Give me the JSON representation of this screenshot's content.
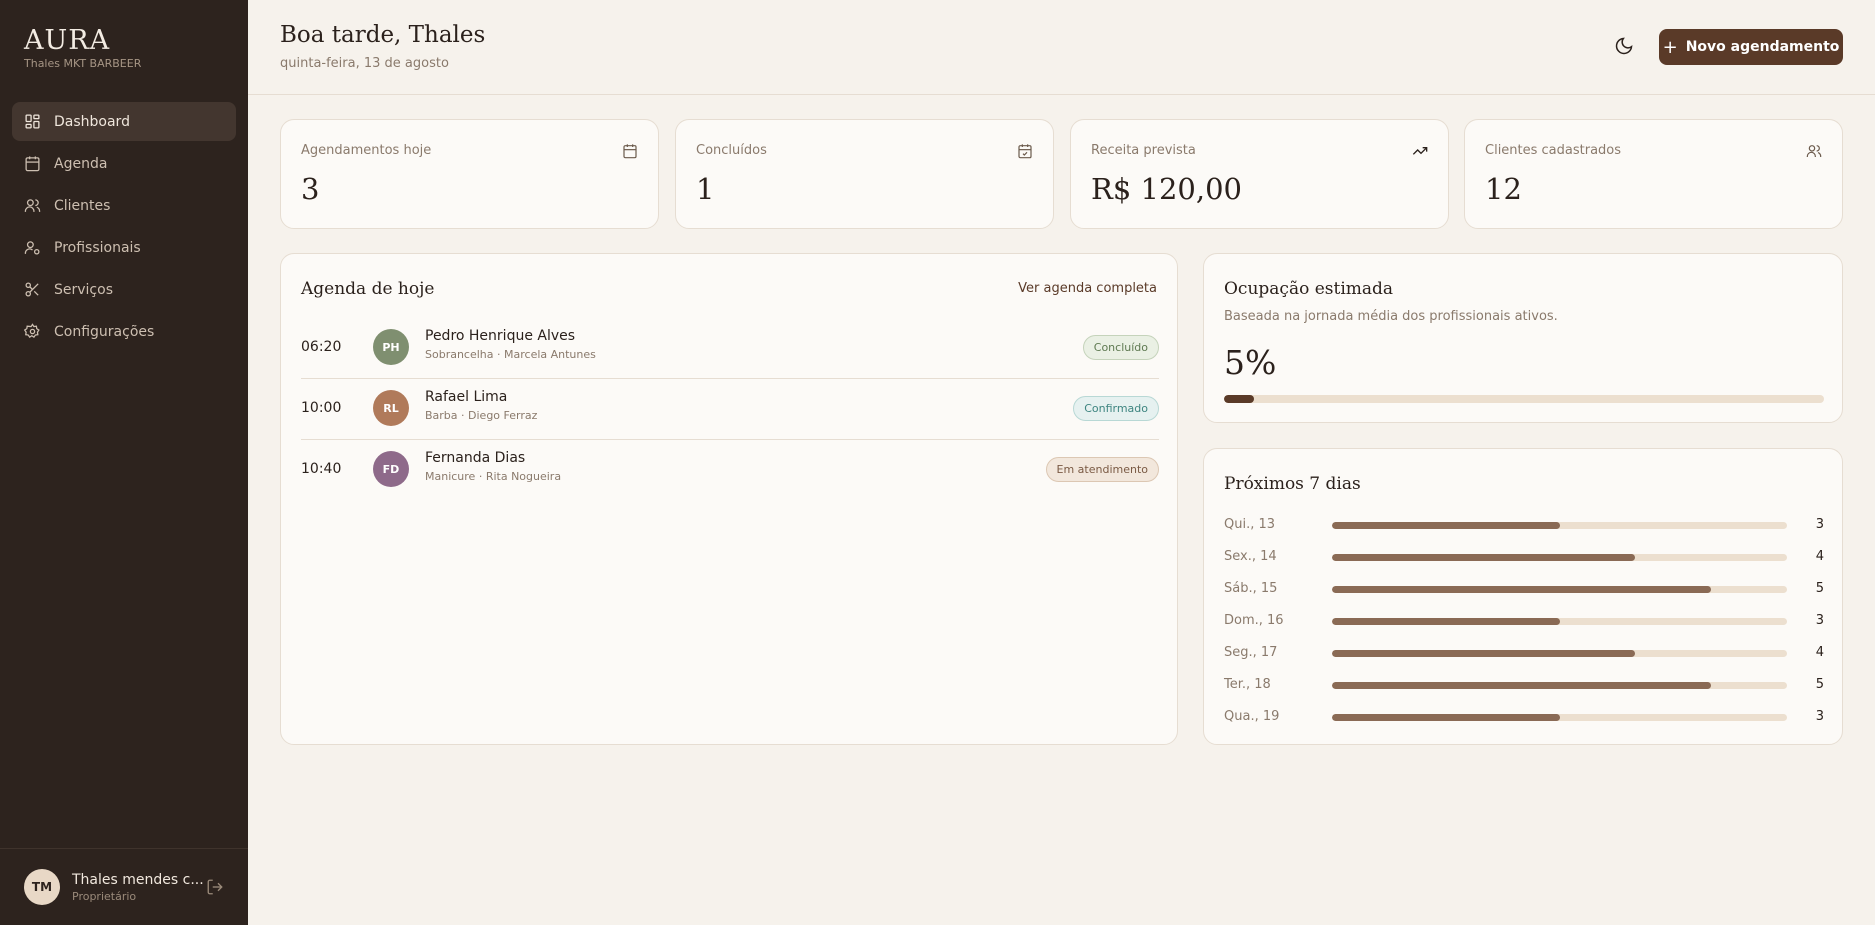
{
  "brand": {
    "logo": "AURA",
    "subtitle": "Thales MKT BARBEER"
  },
  "sidebar": {
    "items": [
      {
        "label": "Dashboard",
        "icon": "dashboard-icon",
        "active": true
      },
      {
        "label": "Agenda",
        "icon": "calendar-icon",
        "active": false
      },
      {
        "label": "Clientes",
        "icon": "users-icon",
        "active": false
      },
      {
        "label": "Profissionais",
        "icon": "professional-icon",
        "active": false
      },
      {
        "label": "Serviços",
        "icon": "scissors-icon",
        "active": false
      },
      {
        "label": "Configurações",
        "icon": "settings-icon",
        "active": false
      }
    ]
  },
  "user": {
    "initials": "TM",
    "name": "Thales mendes c...",
    "role": "Proprietário"
  },
  "header": {
    "greeting": "Boa tarde, Thales",
    "date": "quinta-feira, 13 de agosto",
    "new_button": "Novo agendamento"
  },
  "stats": [
    {
      "label": "Agendamentos hoje",
      "value": "3",
      "icon": "calendar-icon"
    },
    {
      "label": "Concluídos",
      "value": "1",
      "icon": "calendar-check-icon"
    },
    {
      "label": "Receita prevista",
      "value": "R$ 120,00",
      "icon": "trending-up-icon"
    },
    {
      "label": "Clientes cadastrados",
      "value": "12",
      "icon": "users-icon"
    }
  ],
  "agenda": {
    "title": "Agenda de hoje",
    "link": "Ver agenda completa",
    "items": [
      {
        "time": "06:20",
        "initials": "PH",
        "avatar_color": "#7f8f70",
        "name": "Pedro Henrique Alves",
        "detail": "Sobrancelha · Marcela Antunes",
        "status": "Concluído",
        "status_bg": "#eaf0e4",
        "status_fg": "#5f7a52",
        "status_border": "#c5d3bb"
      },
      {
        "time": "10:00",
        "initials": "RL",
        "avatar_color": "#b07a5a",
        "name": "Rafael Lima",
        "detail": "Barba · Diego Ferraz",
        "status": "Confirmado",
        "status_bg": "#e6f1f0",
        "status_fg": "#3e8580",
        "status_border": "#b8d8d5"
      },
      {
        "time": "10:40",
        "initials": "FD",
        "avatar_color": "#8e6a8a",
        "name": "Fernanda Dias",
        "detail": "Manicure · Rita Nogueira",
        "status": "Em atendimento",
        "status_bg": "#f2e7dc",
        "status_fg": "#7a5a44",
        "status_border": "#dcc7b3"
      }
    ]
  },
  "occupancy": {
    "title": "Ocupação estimada",
    "subtitle": "Baseada na jornada média dos profissionais ativos.",
    "value": "5%",
    "fraction": 0.05
  },
  "next_days": {
    "title": "Próximos 7 dias",
    "max": 6,
    "days": [
      {
        "label": "Qui., 13",
        "count": 3
      },
      {
        "label": "Sex., 14",
        "count": 4
      },
      {
        "label": "Sáb., 15",
        "count": 5
      },
      {
        "label": "Dom., 16",
        "count": 3
      },
      {
        "label": "Seg., 17",
        "count": 4
      },
      {
        "label": "Ter., 18",
        "count": 5
      },
      {
        "label": "Qua., 19",
        "count": 3
      }
    ]
  }
}
